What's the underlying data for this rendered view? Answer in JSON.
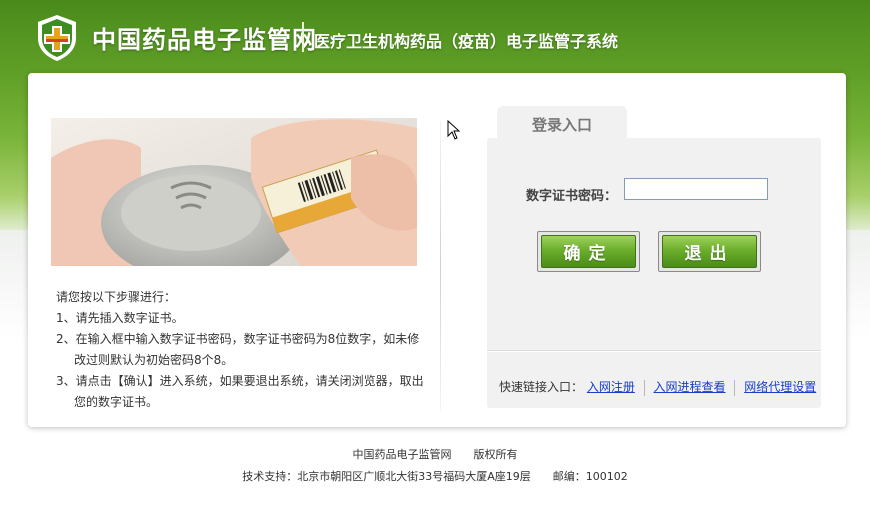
{
  "header": {
    "site_title": "中国药品电子监管网",
    "subsystem_title": "医疗卫生机构药品（疫苗）电子监管子系统"
  },
  "instructions": {
    "intro": "请您按以下步骤进行：",
    "step1": "1、请先插入数字证书。",
    "step2_line1": "2、在输入框中输入数字证书密码，数字证书密码为8位数字，如未修",
    "step2_line2": "改过则默认为初始密码8个8。",
    "step3_line1": "3、请点击【确认】进入系统，如果要退出系统，请关闭浏览器，取出",
    "step3_line2": "您的数字证书。"
  },
  "login": {
    "tab_label": "登录入口",
    "password_label": "数字证书密码：",
    "password_value": "",
    "ok_button": "确定",
    "exit_button": "退出"
  },
  "quick_links": {
    "label": "快速链接入口：",
    "items": [
      "入网注册",
      "入网进程查看",
      "网络代理设置"
    ]
  },
  "footer": {
    "line1": "中国药品电子监管网　　版权所有",
    "line2": "技术支持：北京市朝阳区广顺北大街33号福码大厦A座19层　　邮编：100102"
  },
  "colors": {
    "brand_green": "#5e9e26",
    "button_green": "#6cae2c",
    "link_blue": "#1a3fc4"
  }
}
